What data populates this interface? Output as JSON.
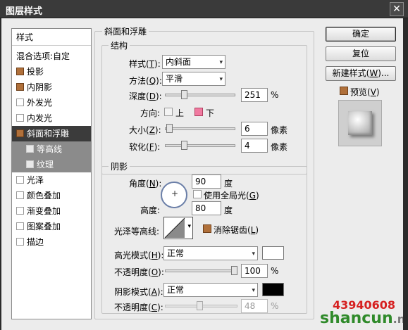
{
  "window": {
    "title": "图层样式",
    "close_glyph": "✕"
  },
  "style_list": {
    "header": "样式",
    "items": [
      {
        "label": "混合选项:自定",
        "checkbox": false,
        "checked": false,
        "state": "normal"
      },
      {
        "label": "投影",
        "checkbox": true,
        "checked": true,
        "state": "normal"
      },
      {
        "label": "内阴影",
        "checkbox": true,
        "checked": true,
        "state": "normal"
      },
      {
        "label": "外发光",
        "checkbox": true,
        "checked": false,
        "state": "normal"
      },
      {
        "label": "内发光",
        "checkbox": true,
        "checked": false,
        "state": "normal"
      },
      {
        "label": "斜面和浮雕",
        "checkbox": true,
        "checked": true,
        "state": "selected"
      },
      {
        "label": "等高线",
        "checkbox": true,
        "checked": false,
        "state": "sub"
      },
      {
        "label": "纹理",
        "checkbox": true,
        "checked": false,
        "state": "sub"
      },
      {
        "label": "光泽",
        "checkbox": true,
        "checked": false,
        "state": "normal"
      },
      {
        "label": "颜色叠加",
        "checkbox": true,
        "checked": false,
        "state": "normal"
      },
      {
        "label": "渐变叠加",
        "checkbox": true,
        "checked": false,
        "state": "normal"
      },
      {
        "label": "图案叠加",
        "checkbox": true,
        "checked": false,
        "state": "normal"
      },
      {
        "label": "描边",
        "checkbox": true,
        "checked": false,
        "state": "normal"
      }
    ]
  },
  "bevel": {
    "section_title": "斜面和浮雕",
    "structure": {
      "legend": "结构",
      "style_label": "样式(",
      "style_key": "T",
      "style_value": "内斜面",
      "technique_label": "方法(",
      "technique_key": "Q",
      "technique_value": "平滑",
      "depth_label": "深度(",
      "depth_key": "D",
      "depth_value": "251",
      "depth_fraction": 0.25,
      "percent": "%",
      "direction_label": "方向:",
      "direction_up": "上",
      "direction_down": "下",
      "size_label": "大小(",
      "size_key": "Z",
      "size_value": "6",
      "size_fraction": 0.02,
      "px_unit": "像素",
      "soften_label": "软化(",
      "soften_key": "F",
      "soften_value": "4",
      "soften_fraction": 0.25,
      "close_paren": "):"
    },
    "shading": {
      "legend": "阴影",
      "angle_label": "角度(",
      "angle_key": "N",
      "angle_value": "90",
      "degree": "度",
      "global_light": "使用全局光(",
      "global_light_key": "G",
      "global_light_close": ")",
      "altitude_label": "高度:",
      "altitude_value": "80",
      "gloss_label": "光泽等高线:",
      "antialias": "消除锯齿(",
      "antialias_key": "L",
      "antialias_close": ")",
      "highlight_mode_label": "高光模式(",
      "highlight_mode_key": "H",
      "highlight_mode_value": "正常",
      "highlight_color": "#ffffff",
      "highlight_opacity_label": "不透明度(",
      "highlight_opacity_key": "O",
      "highlight_opacity_value": "100",
      "highlight_opacity_fraction": 1.0,
      "shadow_mode_label": "阴影模式(",
      "shadow_mode_key": "A",
      "shadow_mode_value": "正常",
      "shadow_color": "#000000",
      "shadow_opacity_label": "不透明度(",
      "shadow_opacity_key": "C",
      "shadow_opacity_value": "48",
      "shadow_opacity_fraction": 0.48,
      "close_paren": "):"
    }
  },
  "buttons": {
    "ok": "确定",
    "reset": "复位",
    "new_style": "新建样式(",
    "new_style_key": "W",
    "new_style_close": ")...",
    "preview": "预览(",
    "preview_key": "V",
    "preview_close": ")"
  },
  "colors": {
    "checked_brown": "#b0703a",
    "selected_bg": "#3b3b3b",
    "down_pink": "#f07aa0"
  },
  "watermark": {
    "number": "43940608",
    "brand_a": "shancun",
    "brand_b": ".net"
  }
}
